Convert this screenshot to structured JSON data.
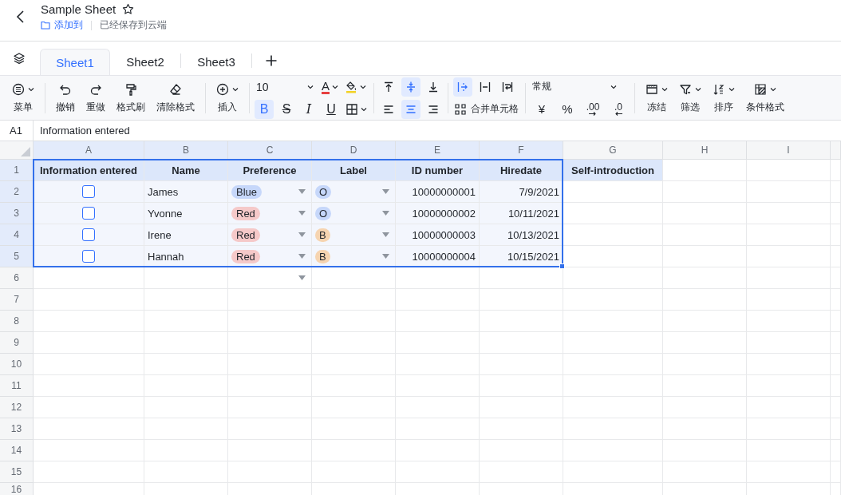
{
  "document": {
    "title": "Sample Sheet",
    "add_to": "添加到",
    "save_status": "已经保存到云端"
  },
  "sheet_tabs": [
    {
      "label": "Sheet1",
      "selected": true
    },
    {
      "label": "Sheet2",
      "selected": false
    },
    {
      "label": "Sheet3",
      "selected": false
    }
  ],
  "toolbar": {
    "menu": "菜单",
    "undo": "撤销",
    "redo": "重做",
    "format_painter": "格式刷",
    "clear_format": "清除格式",
    "insert": "插入",
    "font_size": "10",
    "font_color": "A",
    "styles": [
      {
        "glyph": "B",
        "kind": "bold",
        "selected": true
      },
      {
        "glyph": "S",
        "kind": "strike",
        "selected": false
      },
      {
        "glyph": "I",
        "kind": "italic",
        "selected": false
      },
      {
        "glyph": "U",
        "kind": "underline",
        "selected": false
      }
    ],
    "vertical_align": [
      {
        "kind": "top",
        "selected": false
      },
      {
        "kind": "middle",
        "selected": true
      },
      {
        "kind": "bottom",
        "selected": false
      }
    ],
    "horizontal_align": [
      {
        "kind": "left",
        "selected": false
      },
      {
        "kind": "center",
        "selected": true
      },
      {
        "kind": "right",
        "selected": false
      }
    ],
    "text_wrap": [
      {
        "kind": "overflow",
        "selected": true
      },
      {
        "kind": "clip",
        "selected": false
      },
      {
        "kind": "wrap",
        "selected": false
      }
    ],
    "merge_cells": "合并单元格",
    "number_format": "常规",
    "number_buttons": [
      {
        "glyph": "¥",
        "kind": "plain"
      },
      {
        "glyph": "%",
        "kind": "plain"
      },
      {
        "glyph": ".00",
        "kind": "more"
      },
      {
        "glyph": ".0",
        "kind": "less"
      }
    ],
    "freeze": "冻结",
    "filter": "筛选",
    "sort": "排序",
    "conditional_format": "条件格式"
  },
  "formula_bar": {
    "cell": "A1",
    "content": "Information entered"
  },
  "columns": [
    {
      "label": "A",
      "selected": true
    },
    {
      "label": "B",
      "selected": true
    },
    {
      "label": "C",
      "selected": true
    },
    {
      "label": "D",
      "selected": true
    },
    {
      "label": "E",
      "selected": true
    },
    {
      "label": "F",
      "selected": true
    },
    {
      "label": "G",
      "selected": false
    },
    {
      "label": "H",
      "selected": false
    },
    {
      "label": "I",
      "selected": false
    }
  ],
  "rows": [
    {
      "kind": "header",
      "number": "1",
      "selected": true,
      "headings": [
        "Information entered",
        "Name",
        "Preference",
        "Label",
        "ID number",
        "Hiredate",
        "Self-introduction"
      ]
    },
    {
      "kind": "record",
      "number": "2",
      "selected": true,
      "entered": false,
      "name": "James",
      "preference": {
        "text": "Blue",
        "color": "#c6d7fa"
      },
      "label": {
        "text": "O",
        "color": "#c6d7fa"
      },
      "id_number": "10000000001",
      "hiredate": "7/9/2021"
    },
    {
      "kind": "record",
      "number": "3",
      "selected": true,
      "entered": false,
      "name": "Yvonne",
      "preference": {
        "text": "Red",
        "color": "#f5c9c9"
      },
      "label": {
        "text": "O",
        "color": "#c6d7fa"
      },
      "id_number": "10000000002",
      "hiredate": "10/11/2021"
    },
    {
      "kind": "record",
      "number": "4",
      "selected": true,
      "entered": false,
      "name": "Irene",
      "preference": {
        "text": "Red",
        "color": "#f5c9c9"
      },
      "label": {
        "text": "B",
        "color": "#f6d4b0"
      },
      "id_number": "10000000003",
      "hiredate": "10/13/2021"
    },
    {
      "kind": "record",
      "number": "5",
      "selected": true,
      "entered": false,
      "name": "Hannah",
      "preference": {
        "text": "Red",
        "color": "#f5c9c9"
      },
      "label": {
        "text": "B",
        "color": "#f6d4b0"
      },
      "id_number": "10000000004",
      "hiredate": "10/15/2021"
    },
    {
      "kind": "empty",
      "number": "6",
      "selected": false,
      "dropdown": true
    },
    {
      "kind": "empty",
      "number": "7",
      "selected": false,
      "dropdown": false
    },
    {
      "kind": "empty",
      "number": "8",
      "selected": false,
      "dropdown": false
    },
    {
      "kind": "empty",
      "number": "9",
      "selected": false,
      "dropdown": false
    },
    {
      "kind": "empty",
      "number": "10",
      "selected": false,
      "dropdown": false
    },
    {
      "kind": "empty",
      "number": "11",
      "selected": false,
      "dropdown": false
    },
    {
      "kind": "empty",
      "number": "12",
      "selected": false,
      "dropdown": false
    },
    {
      "kind": "empty",
      "number": "13",
      "selected": false,
      "dropdown": false
    },
    {
      "kind": "empty",
      "number": "14",
      "selected": false,
      "dropdown": false
    },
    {
      "kind": "empty",
      "number": "15",
      "selected": false,
      "dropdown": false
    },
    {
      "kind": "empty",
      "number": "16",
      "selected": false,
      "dropdown": false
    }
  ]
}
